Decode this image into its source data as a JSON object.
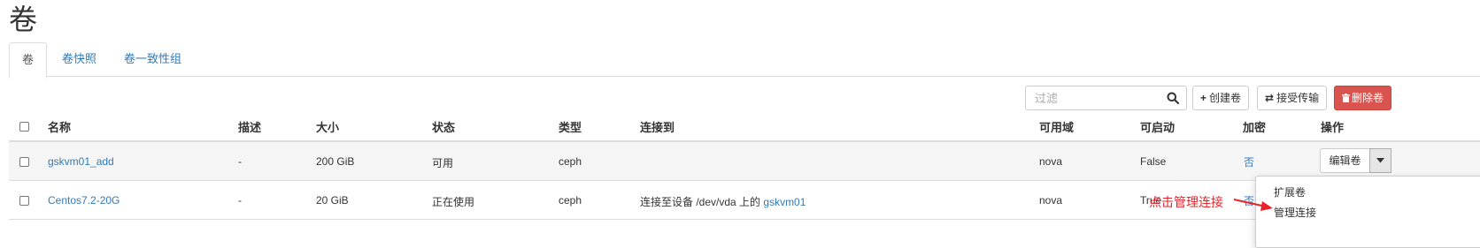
{
  "page": {
    "title": "卷"
  },
  "tabs": [
    {
      "label": "卷",
      "active": true
    },
    {
      "label": "卷快照",
      "active": false
    },
    {
      "label": "卷一致性组",
      "active": false
    }
  ],
  "toolbar": {
    "filter_placeholder": "过滤",
    "create_label": "创建卷",
    "accept_transfer_label": "接受传输",
    "delete_label": "删除卷",
    "search_icon": "search-icon",
    "plus_icon": "plus-icon",
    "transfer_icon": "transfer-icon",
    "trash_icon": "trash-icon"
  },
  "table": {
    "columns": [
      "名称",
      "描述",
      "大小",
      "状态",
      "类型",
      "连接到",
      "可用域",
      "可启动",
      "加密",
      "操作"
    ],
    "rows": [
      {
        "name": "gskvm01_add",
        "description": "-",
        "size": "200 GiB",
        "status": "可用",
        "type": "ceph",
        "attached_prefix": "",
        "attached_link": "",
        "zone": "nova",
        "bootable": "False",
        "encrypted": "否",
        "action": "编辑卷"
      },
      {
        "name": "Centos7.2-20G",
        "description": "-",
        "size": "20 GiB",
        "status": "正在使用",
        "type": "ceph",
        "attached_prefix": "连接至设备 /dev/vda 上的",
        "attached_link": "gskvm01",
        "zone": "nova",
        "bootable": "True",
        "encrypted": "否"
      }
    ]
  },
  "dropdown": {
    "items": [
      "扩展卷",
      "管理连接"
    ]
  },
  "annotation": {
    "text": "点击管理连接",
    "color": "#e8232b"
  },
  "colors": {
    "link": "#337ab7",
    "danger": "#d9534f"
  }
}
